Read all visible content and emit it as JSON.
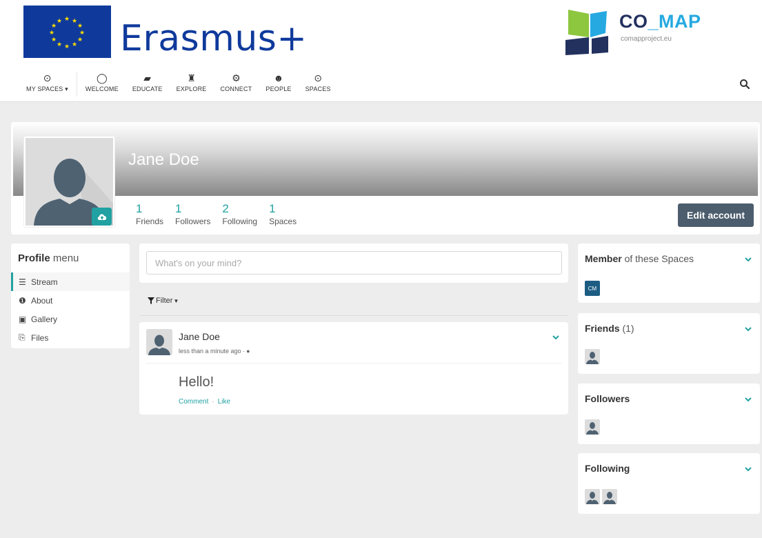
{
  "brand": {
    "erasmus_text": "Erasmus+",
    "comap_title_a": "CO",
    "comap_title_b": "_",
    "comap_title_c": "MAP",
    "comap_site": "comapproject.eu"
  },
  "nav": {
    "items": [
      {
        "label": "MY SPACES",
        "icon": "target-icon"
      },
      {
        "label": "WELCOME",
        "icon": "leaf-icon"
      },
      {
        "label": "EDUCATE",
        "icon": "book-icon"
      },
      {
        "label": "EXPLORE",
        "icon": "binoculars-icon"
      },
      {
        "label": "CONNECT",
        "icon": "cogs-icon"
      },
      {
        "label": "PEOPLE",
        "icon": "users-icon"
      },
      {
        "label": "SPACES",
        "icon": "target-icon"
      }
    ]
  },
  "profile": {
    "name": "Jane Doe",
    "stats": [
      {
        "num": "1",
        "label": "Friends"
      },
      {
        "num": "1",
        "label": "Followers"
      },
      {
        "num": "2",
        "label": "Following"
      },
      {
        "num": "1",
        "label": "Spaces"
      }
    ],
    "edit_label": "Edit account"
  },
  "menu": {
    "title_bold": "Profile",
    "title_rest": " menu",
    "items": [
      {
        "label": "Stream",
        "icon": "≡"
      },
      {
        "label": "About",
        "icon": "ℹ"
      },
      {
        "label": "Gallery",
        "icon": "▣"
      },
      {
        "label": "Files",
        "icon": "⎘"
      }
    ]
  },
  "composer": {
    "placeholder": "What's on your mind?"
  },
  "filter": {
    "label": "Filter"
  },
  "post": {
    "author": "Jane Doe",
    "time": "less than a minute ago · ",
    "body": "Hello!",
    "comment": "Comment",
    "sep": "·",
    "like": "Like"
  },
  "panels": {
    "member_bold": "Member",
    "member_rest": " of these Spaces",
    "space_badge": "CM",
    "friends_bold": "Friends",
    "friends_count": " (1)",
    "followers": "Followers",
    "following": "Following"
  },
  "colors": {
    "accent": "#21a1a1",
    "button": "#4c5d6d",
    "space_badge": "#1d5d84",
    "erasmus_blue": "#0f3a9c"
  }
}
